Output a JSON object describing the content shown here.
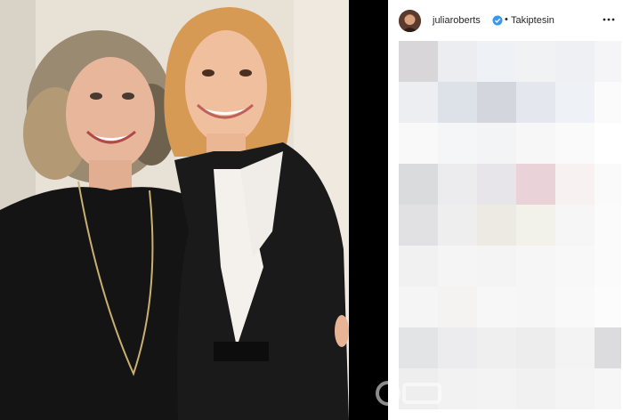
{
  "post": {
    "header": {
      "username": "juliaroberts",
      "separator": "•",
      "follow_status": "Takiptesin"
    },
    "icons": {
      "verified": "verified-badge-icon",
      "more": "more-options-icon",
      "avatar": "profile-avatar"
    },
    "colors": {
      "verified_blue": "#3897f0",
      "text": "#262626",
      "photo_frame": "#000000"
    }
  }
}
